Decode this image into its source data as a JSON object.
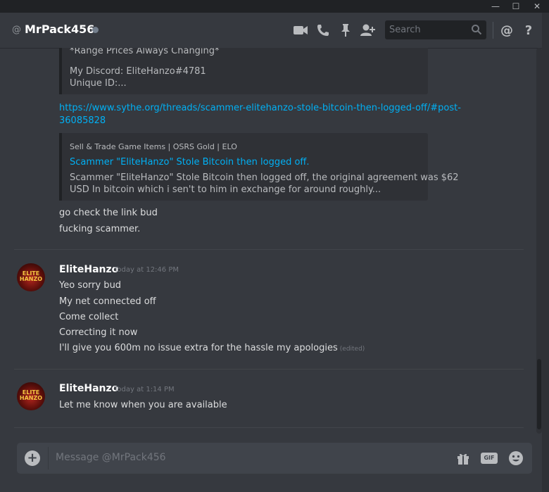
{
  "window": {
    "minimize": "—",
    "maximize": "☐",
    "close": "✕"
  },
  "header": {
    "at": "@",
    "username": "MrPack456",
    "search_placeholder": "Search",
    "icons": [
      "video-call-icon",
      "phone-call-icon",
      "pin-icon",
      "add-friend-icon",
      "search-icon",
      "mention-icon",
      "help-icon"
    ],
    "mention": "@",
    "help": "?"
  },
  "messages": {
    "embed1": {
      "line1": "*Range Prices Always Changing*",
      "line2": "My Discord: EliteHanzo#4781",
      "line3": "Unique ID:..."
    },
    "link_line1": "https://www.sythe.org/threads/scammer-elitehanzo-stole-bitcoin-then-logged-off/#post-",
    "link_line2": "36085828",
    "embed2": {
      "provider": "Sell & Trade Game Items | OSRS Gold | ELO",
      "title": "Scammer \"EliteHanzo\" Stole Bitcoin then logged off.",
      "desc1": "Scammer \"EliteHanzo\" Stole Bitcoin then logged off, the original agreement was $62",
      "desc2": "USD In bitcoin which i sen't to him in exchange for around roughly..."
    },
    "line_a": "go check the link bud",
    "line_b": "fucking scammer.",
    "group1": {
      "author": "EliteHanzo",
      "timestamp": "Today at 12:46 PM",
      "lines": [
        "Yeo sorry bud",
        "My net connected off",
        "Come collect",
        "Correcting it now",
        "I'll give you 600m no issue extra for the hassle my apologies"
      ],
      "edited": "(edited)"
    },
    "group2": {
      "author": "EliteHanzo",
      "timestamp": "Today at 1:14 PM",
      "lines": [
        "Let me know when you are available"
      ]
    },
    "avatar_text": [
      "ELITE",
      "HANZO"
    ]
  },
  "composer": {
    "placeholder": "Message @MrPack456",
    "plus": "+",
    "gif": "GIF"
  },
  "colors": {
    "background": "#36393f",
    "link": "#00b0f4",
    "embed_bg": "#2f3136",
    "status_offline": "#747f8d"
  }
}
